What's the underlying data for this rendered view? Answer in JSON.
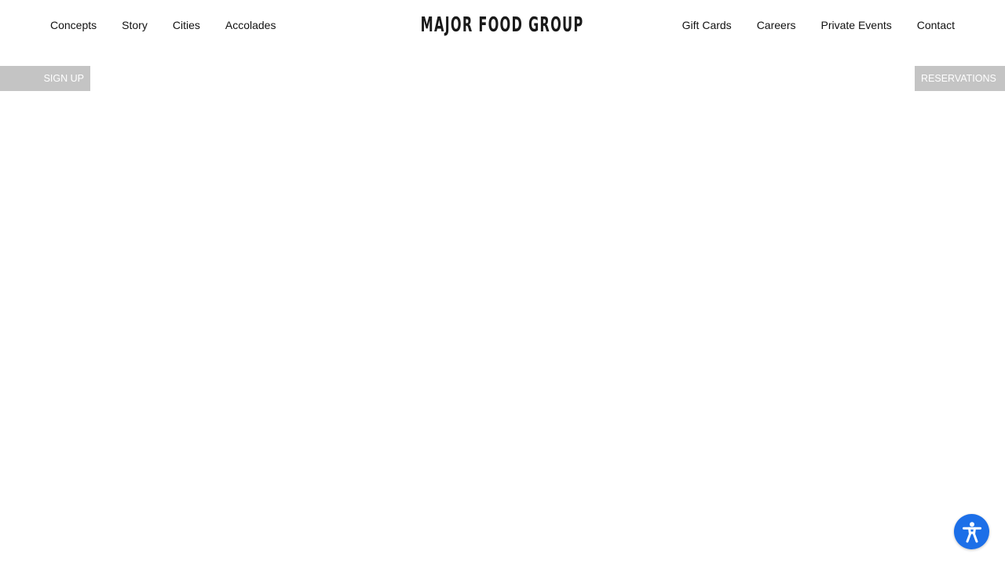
{
  "header": {
    "nav_left": [
      {
        "label": "Concepts"
      },
      {
        "label": "Story"
      },
      {
        "label": "Cities"
      },
      {
        "label": "Accolades"
      }
    ],
    "logo_text": "MAJOR FOOD GROUP",
    "nav_right": [
      {
        "label": "Gift Cards"
      },
      {
        "label": "Careers"
      },
      {
        "label": "Private Events"
      },
      {
        "label": "Contact"
      }
    ]
  },
  "side_buttons": {
    "signup_label": "SIGN UP",
    "reservations_label": "RESERVATIONS"
  },
  "accessibility": {
    "icon": "accessibility-person-icon",
    "color": "#1c6fe8"
  },
  "colors": {
    "side_button_bg": "#c4c4c4",
    "text": "#111111"
  }
}
